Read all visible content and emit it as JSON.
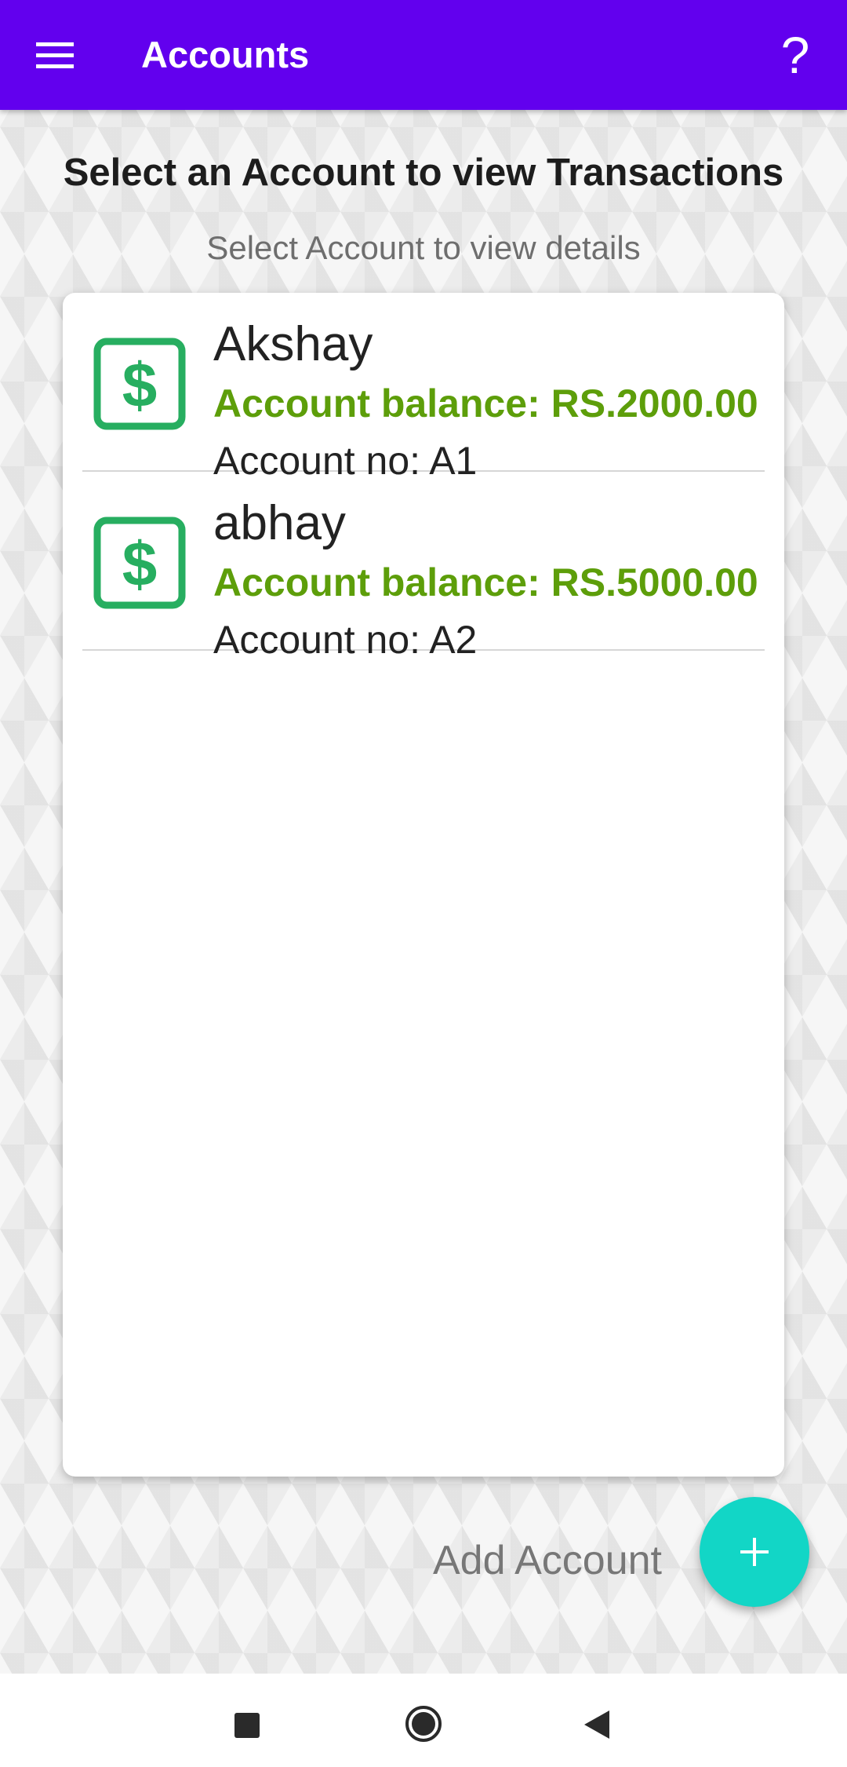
{
  "appbar": {
    "title": "Accounts",
    "menu_icon": "hamburger-menu-icon",
    "help_icon": "question-mark-icon",
    "help_glyph": "?",
    "color": "#6200ee"
  },
  "heading": "Select an Account to view Transactions",
  "subheading": "Select Account to view details",
  "accounts": [
    {
      "name": "Akshay",
      "balance": "Account balance: RS.2000.00",
      "account_no": "Account no: A1",
      "icon": "dollar-icon"
    },
    {
      "name": "abhay",
      "balance": "Account balance: RS.5000.00",
      "account_no": "Account no: A2",
      "icon": "dollar-icon"
    }
  ],
  "add_account": {
    "label": "Add Account",
    "icon": "plus-icon",
    "color": "#12d6c6"
  },
  "colors": {
    "balance": "#5d9e0a",
    "icon_green": "#27ae60"
  },
  "navbar": {
    "recents_icon": "square-recents-icon",
    "home_icon": "circle-home-icon",
    "back_icon": "triangle-back-icon"
  }
}
